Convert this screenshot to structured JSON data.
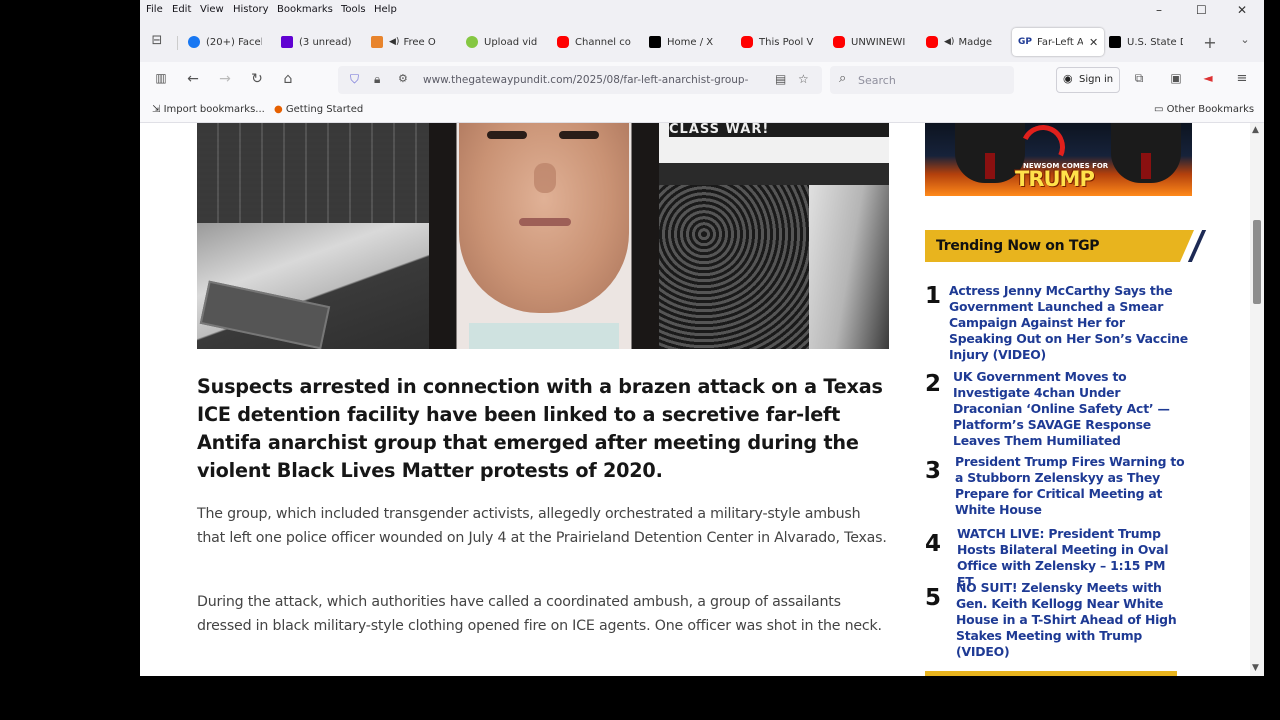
{
  "menu": {
    "items": [
      "File",
      "Edit",
      "View",
      "History",
      "Bookmarks",
      "Tools",
      "Help"
    ],
    "window_controls": [
      "–",
      "☐",
      "✕"
    ]
  },
  "tabs": [
    {
      "label": "(20+) Faceb",
      "icon": "facebook-icon",
      "color": "#1877f2",
      "audio": false
    },
    {
      "label": "(3 unread)",
      "icon": "yahoo-mail-icon",
      "color": "#6001d2",
      "audio": false
    },
    {
      "label": "Free O",
      "icon": "mail-icon",
      "color": "#e8842c",
      "audio": true
    },
    {
      "label": "Upload vid",
      "icon": "rumble-icon",
      "color": "#85c742",
      "audio": false
    },
    {
      "label": "Channel co",
      "icon": "youtube-icon",
      "color": "#ff0000",
      "audio": false
    },
    {
      "label": "Home / X",
      "icon": "x-icon",
      "color": "#000000",
      "audio": false
    },
    {
      "label": "This Pool V",
      "icon": "youtube-icon",
      "color": "#ff0000",
      "audio": false
    },
    {
      "label": "UNWINEWI",
      "icon": "youtube-icon",
      "color": "#ff0000",
      "audio": false
    },
    {
      "label": "Madge",
      "icon": "youtube-icon",
      "color": "#ff0000",
      "audio": true
    },
    {
      "label": "Far-Left A",
      "icon": "gp-icon",
      "color": "#1e3a94",
      "audio": false,
      "active": true
    },
    {
      "label": "U.S. State D",
      "icon": "x-icon",
      "color": "#000000",
      "audio": false
    }
  ],
  "nav": {
    "url": "www.thegatewaypundit.com/2025/08/far-left-anarchist-group-",
    "search_placeholder": "Search",
    "signin_label": "Sign in"
  },
  "bookmarks": {
    "import_label": "Import bookmarks...",
    "getting_started": "Getting Started",
    "other": "Other Bookmarks"
  },
  "hero": {
    "panel3_text": "CLASS WAR!"
  },
  "article": {
    "headline": "Suspects arrested in connection with a brazen attack on a Texas ICE detention facility have been linked to a secretive far-left Antifa anarchist group that emerged after meeting during the violent Black Lives Matter protests of 2020.",
    "p1": "The group, which included transgender activists, allegedly orchestrated a military-style ambush that left one police officer wounded on July 4 at the Prairieland Detention Center in Alvarado, Texas.",
    "p2": "During the attack, which authorities have called a coordinated ambush, a group of assailants dressed in black military-style clothing opened fire on ICE agents. One officer was shot in the neck."
  },
  "ad": {
    "caption": "NEWSOM COMES FOR",
    "big": "TRUMP"
  },
  "trending": {
    "title": "Trending Now on TGP",
    "items": [
      {
        "num": "1",
        "text": "Actress Jenny McCarthy Says the Government Launched a Smear Campaign Against Her for Speaking Out on Her Son’s Vaccine Injury (VIDEO)"
      },
      {
        "num": "2",
        "text": "UK Government Moves to Investigate 4chan Under Draconian ‘Online Safety Act’ — Platform’s SAVAGE Response Leaves Them Humiliated"
      },
      {
        "num": "3",
        "text": "President Trump Fires Warning to a Stubborn Zelenskyy as They Prepare for Critical Meeting at White House"
      },
      {
        "num": "4",
        "text": "WATCH LIVE: President Trump Hosts Bilateral Meeting in Oval Office with Zelensky – 1:15 PM ET"
      },
      {
        "num": "5",
        "text": "NO SUIT! Zelensky Meets with Gen. Keith Kellogg Near White House in a T-Shirt Ahead of High Stakes Meeting with Trump (VIDEO)"
      }
    ]
  }
}
